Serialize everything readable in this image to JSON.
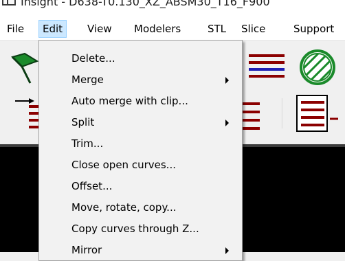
{
  "window": {
    "title": "Insight - D638-T0.130_XZ_ABSM30_T16_F900"
  },
  "menubar": {
    "items": [
      {
        "label": "File",
        "active": false
      },
      {
        "label": "Edit",
        "active": true
      },
      {
        "label": "View",
        "active": false
      },
      {
        "label": "Modelers",
        "active": false
      },
      {
        "label": "STL",
        "active": false
      },
      {
        "label": "Slice",
        "active": false
      },
      {
        "label": "Support",
        "active": false
      }
    ]
  },
  "edit_menu": {
    "items": [
      {
        "label": "Delete...",
        "has_submenu": false
      },
      {
        "label": "Merge",
        "has_submenu": true
      },
      {
        "label": "Auto merge with clip...",
        "has_submenu": false
      },
      {
        "label": "Split",
        "has_submenu": true
      },
      {
        "label": "Trim...",
        "has_submenu": false
      },
      {
        "label": "Close open curves...",
        "has_submenu": false
      },
      {
        "label": "Offset...",
        "has_submenu": false
      },
      {
        "label": "Move, rotate, copy...",
        "has_submenu": false
      },
      {
        "label": "Copy curves through Z...",
        "has_submenu": false
      },
      {
        "label": "Mirror",
        "has_submenu": true
      }
    ]
  },
  "toolbar": {
    "row1": [
      "flag-icon",
      "layers-lines-icon",
      "hatch-circle-icon"
    ],
    "row2": [
      "arrow-layers-icon",
      "stripes-icon",
      "stripes-framed-icon"
    ]
  },
  "colors": {
    "menu_highlight": "#cce8ff",
    "menu_highlight_border": "#99d1ff",
    "icon_dark_red": "#8b0000",
    "icon_blue": "#1e1eb4",
    "icon_green": "#1a8a2a",
    "viewport": "#000000"
  }
}
